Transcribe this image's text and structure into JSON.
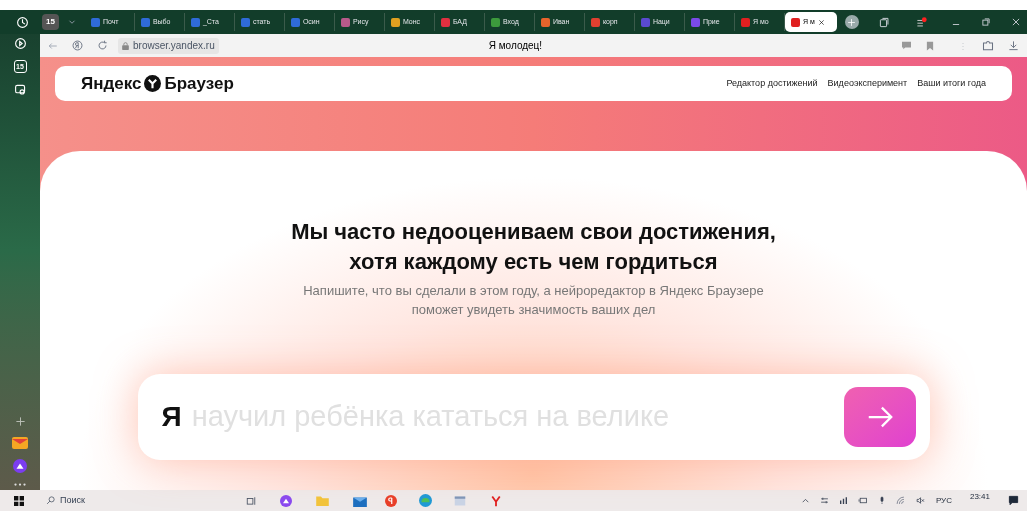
{
  "tab_bar": {
    "tab_count": "15",
    "tabs": [
      {
        "label": "Почт",
        "selected": false,
        "color": "#2f6bd8"
      },
      {
        "label": "Выбо",
        "selected": false,
        "color": "#2f6bd8"
      },
      {
        "label": "_Ста",
        "selected": false,
        "color": "#2f6bd8"
      },
      {
        "label": "стать",
        "selected": false,
        "color": "#2f6bd8"
      },
      {
        "label": "Осин",
        "selected": false,
        "color": "#2f6bd8"
      },
      {
        "label": "Рису",
        "selected": false,
        "color": "#b85a8a"
      },
      {
        "label": "Монс",
        "selected": false,
        "color": "#e0a020"
      },
      {
        "label": "БАД",
        "selected": false,
        "color": "#e03040"
      },
      {
        "label": "Вход",
        "selected": false,
        "color": "#3c9a3c"
      },
      {
        "label": "Иван",
        "selected": false,
        "color": "#e8642c"
      },
      {
        "label": "корп",
        "selected": false,
        "color": "#e04030"
      },
      {
        "label": "Наци",
        "selected": false,
        "color": "#5a4ad0"
      },
      {
        "label": "Прие",
        "selected": false,
        "color": "#7a4ae8"
      },
      {
        "label": "Я мо",
        "selected": false,
        "color": "#e02020"
      },
      {
        "label": "Я м",
        "selected": true,
        "color": "#e02020"
      }
    ]
  },
  "address_bar": {
    "url": "browser.yandex.ru",
    "page_title": "Я молодец!"
  },
  "sidebar": {
    "calendar_day": "15"
  },
  "site_header": {
    "logo_left": "Яндекс",
    "logo_right": "Браузер",
    "links": [
      "Редактор достижений",
      "Видеоэксперимент",
      "Ваши итоги года"
    ]
  },
  "hero": {
    "heading_lines": [
      "Мы часто недооцениваем свои достижения,",
      "хотя каждому есть чем гордиться"
    ],
    "subtitle_lines": [
      "Напишите, что вы сделали в этом году, а нейроредактор в Яндекс Браузере",
      "поможет увидеть значимость ваших дел"
    ],
    "input_prefix": "Я",
    "input_placeholder": "научил ребёнка кататься на велике"
  },
  "taskbar": {
    "search_placeholder": "Поиск",
    "language": "РУС",
    "time": "23:41"
  }
}
